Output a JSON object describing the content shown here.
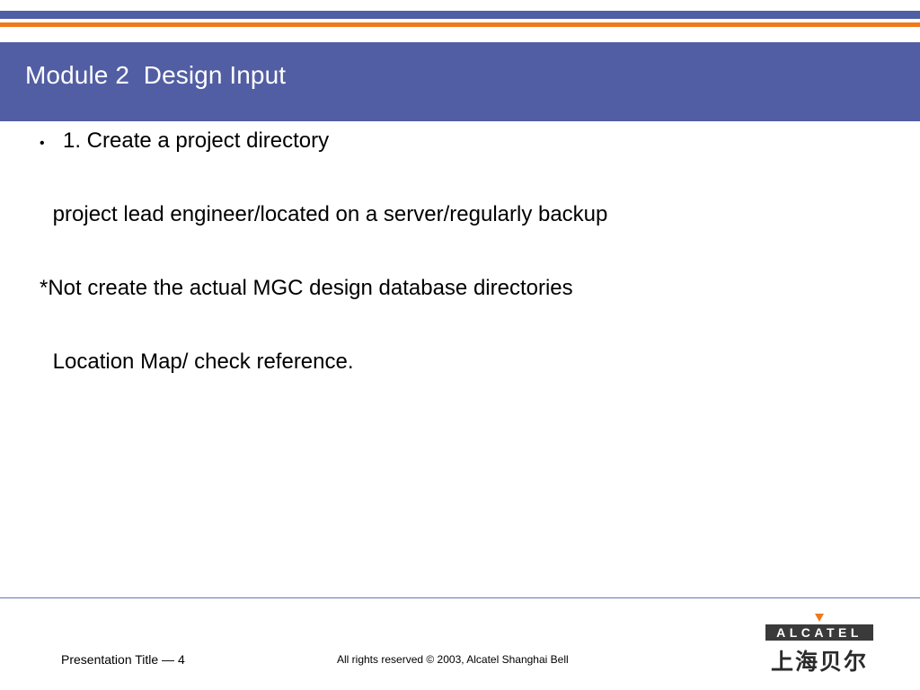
{
  "slide": {
    "title": "Module 2  Design Input",
    "bullet_symbol": "•",
    "lines": [
      "1. Create a project directory",
      " project lead engineer/located on a server/regularly backup",
      "*Not create the actual MGC design database directories",
      " Location Map/ check reference."
    ]
  },
  "footer": {
    "left": "Presentation Title — 4",
    "center": "All rights reserved © 2003, Alcatel Shanghai Bell"
  },
  "logo": {
    "wordmark": "ALCATEL",
    "chinese": "上海贝尔"
  },
  "colors": {
    "header_bg": "#525ea3",
    "stripe_blue": "#4f5fa6",
    "stripe_orange": "#ee7a1c",
    "logo_orange": "#ee7a1c",
    "logo_bar": "#3a3a3a"
  }
}
